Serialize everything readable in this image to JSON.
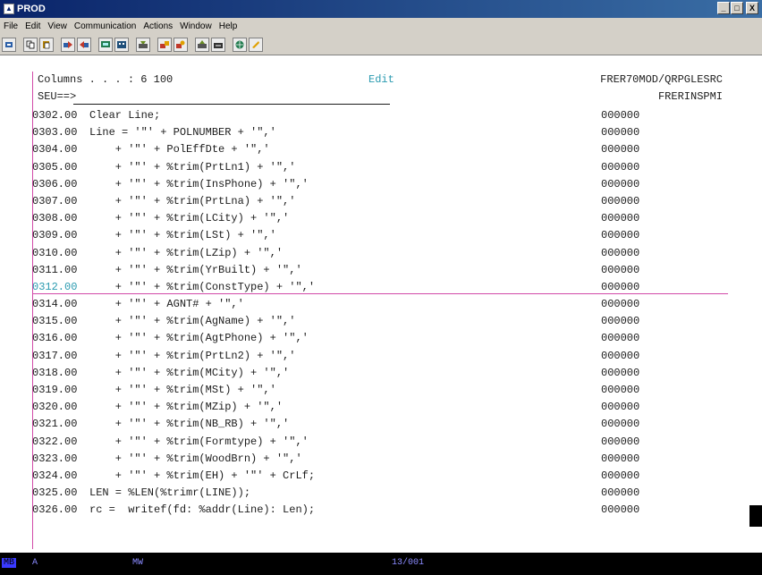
{
  "window": {
    "title": "PROD",
    "controls": [
      "_",
      "□",
      "X"
    ]
  },
  "menu": [
    {
      "label": "File"
    },
    {
      "label": "Edit"
    },
    {
      "label": "View"
    },
    {
      "label": "Communication"
    },
    {
      "label": "Actions"
    },
    {
      "label": "Window"
    },
    {
      "label": "Help"
    }
  ],
  "toolbar": {
    "icons": [
      "print-screen-icon",
      "copy-icon",
      "paste-icon",
      "send-icon",
      "receive-icon",
      "display-icon",
      "keypad-icon",
      "record-macro-icon",
      "stop-macro-icon",
      "play-macro-icon",
      "macro-icon",
      "customize-icon",
      "help-icon"
    ]
  },
  "screen": {
    "columns_text": "Columns . . . :    6 100",
    "mode": "Edit",
    "library": "FRER70MOD/QRPGLESRC",
    "prompt": "SEU==>",
    "member": "FRERINSPMI",
    "rows": [
      {
        "seq": "0302.00",
        "src": "Clear Line;",
        "date": "000000"
      },
      {
        "seq": "0303.00",
        "src": "Line = '\"' + POLNUMBER + '\",'",
        "date": "000000"
      },
      {
        "seq": "0304.00",
        "src": "    + '\"' + PolEffDte + '\",'",
        "date": "000000"
      },
      {
        "seq": "0305.00",
        "src": "    + '\"' + %trim(PrtLn1) + '\",'",
        "date": "000000"
      },
      {
        "seq": "0306.00",
        "src": "    + '\"' + %trim(InsPhone) + '\",'",
        "date": "000000"
      },
      {
        "seq": "0307.00",
        "src": "    + '\"' + %trim(PrtLna) + '\",'",
        "date": "000000"
      },
      {
        "seq": "0308.00",
        "src": "    + '\"' + %trim(LCity) + '\",'",
        "date": "000000"
      },
      {
        "seq": "0309.00",
        "src": "    + '\"' + %trim(LSt) + '\",'",
        "date": "000000"
      },
      {
        "seq": "0310.00",
        "src": "    + '\"' + %trim(LZip) + '\",'",
        "date": "000000"
      },
      {
        "seq": "0311.00",
        "src": "    + '\"' + %trim(YrBuilt) + '\",'",
        "date": "000000"
      },
      {
        "seq": "0312.00",
        "src": "    + '\"' + %trim(ConstType) + '\",'",
        "date": "000000",
        "cursor": true
      },
      {
        "seq": "0314.00",
        "src": "    + '\"' + AGNT# + '\",'",
        "date": "000000"
      },
      {
        "seq": "0315.00",
        "src": "    + '\"' + %trim(AgName) + '\",'",
        "date": "000000"
      },
      {
        "seq": "0316.00",
        "src": "    + '\"' + %trim(AgtPhone) + '\",'",
        "date": "000000"
      },
      {
        "seq": "0317.00",
        "src": "    + '\"' + %trim(PrtLn2) + '\",'",
        "date": "000000"
      },
      {
        "seq": "0318.00",
        "src": "    + '\"' + %trim(MCity) + '\",'",
        "date": "000000"
      },
      {
        "seq": "0319.00",
        "src": "    + '\"' + %trim(MSt) + '\",'",
        "date": "000000"
      },
      {
        "seq": "0320.00",
        "src": "    + '\"' + %trim(MZip) + '\",'",
        "date": "000000"
      },
      {
        "seq": "0321.00",
        "src": "    + '\"' + %trim(NB_RB) + '\",'",
        "date": "000000"
      },
      {
        "seq": "0322.00",
        "src": "    + '\"' + %trim(Formtype) + '\",'",
        "date": "000000"
      },
      {
        "seq": "0323.00",
        "src": "    + '\"' + %trim(WoodBrn) + '\",'",
        "date": "000000"
      },
      {
        "seq": "0324.00",
        "src": "    + '\"' + %trim(EH) + '\"' + CrLf;",
        "date": "000000"
      },
      {
        "seq": "0325.00",
        "src": "LEN = %LEN(%trimr(LINE));",
        "date": "000000"
      },
      {
        "seq": "0326.00",
        "src": "rc =  writef(fd: %addr(Line): Len);",
        "date": "000000"
      }
    ]
  },
  "status": {
    "session": "MB",
    "indicator": "A",
    "mode": "MW",
    "cursor_pos": "13/001"
  },
  "colors": {
    "accent": "#2a9ab0",
    "border": "#d24aa8"
  }
}
